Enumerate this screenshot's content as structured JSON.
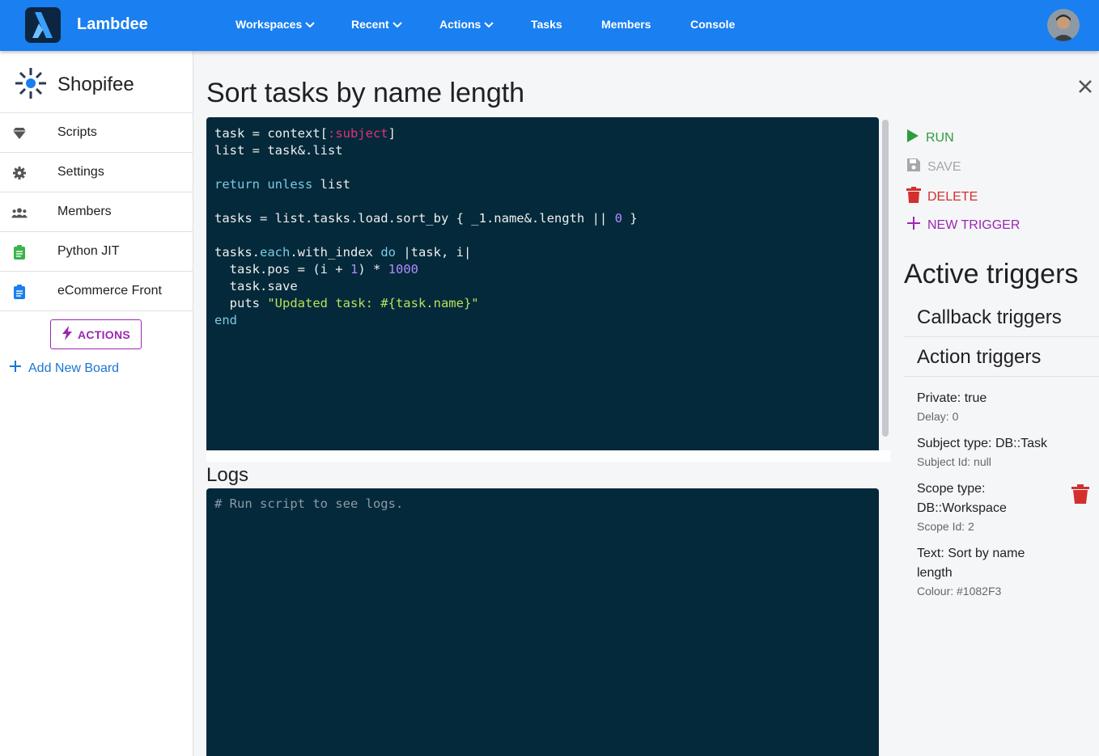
{
  "app": {
    "brand": "Lambdee",
    "nav": [
      {
        "label": "Workspaces",
        "dropdown": true
      },
      {
        "label": "Recent",
        "dropdown": true
      },
      {
        "label": "Actions",
        "dropdown": true
      },
      {
        "label": "Tasks",
        "dropdown": false
      },
      {
        "label": "Members",
        "dropdown": false
      },
      {
        "label": "Console",
        "dropdown": false
      }
    ],
    "accent_color": "#1a7ff0"
  },
  "sidebar": {
    "workspace_name": "Shopifee",
    "items": [
      {
        "label": "Scripts",
        "icon": "gem-icon"
      },
      {
        "label": "Settings",
        "icon": "gear-icon"
      },
      {
        "label": "Members",
        "icon": "users-icon"
      },
      {
        "label": "Python JIT",
        "icon": "clipboard-icon"
      },
      {
        "label": "eCommerce Front",
        "icon": "clipboard-icon"
      }
    ],
    "actions_label": "ACTIONS",
    "add_board_label": "Add New Board"
  },
  "main": {
    "title": "Sort tasks by name length",
    "code_lines": [
      "task = context[:subject]",
      "list = task&.list",
      "",
      "return unless list",
      "",
      "tasks = list.tasks.load.sort_by { _1.name&.length || 0 }",
      "",
      "tasks.each.with_index do |task, i|",
      "  task.pos = (i + 1) * 1000",
      "  task.save",
      "  puts \"Updated task: #{task.name}\"",
      "end"
    ],
    "logs_title": "Logs",
    "logs_placeholder": "# Run script to see logs."
  },
  "right_panel": {
    "run_label": "RUN",
    "save_label": "SAVE",
    "delete_label": "DELETE",
    "new_trigger_label": "NEW TRIGGER",
    "active_triggers_title": "Active triggers",
    "callback_triggers_label": "Callback triggers",
    "action_triggers_label": "Action triggers",
    "trigger": {
      "private": "Private: true",
      "delay": "Delay: 0",
      "subject_type": "Subject type: DB::Task",
      "subject_id": "Subject Id: null",
      "scope_type_line1": "Scope type:",
      "scope_type_line2": "DB::Workspace",
      "scope_id": "Scope Id: 2",
      "text_line1": "Text: Sort by name",
      "text_line2": "length",
      "colour": "Colour: #1082F3"
    }
  }
}
